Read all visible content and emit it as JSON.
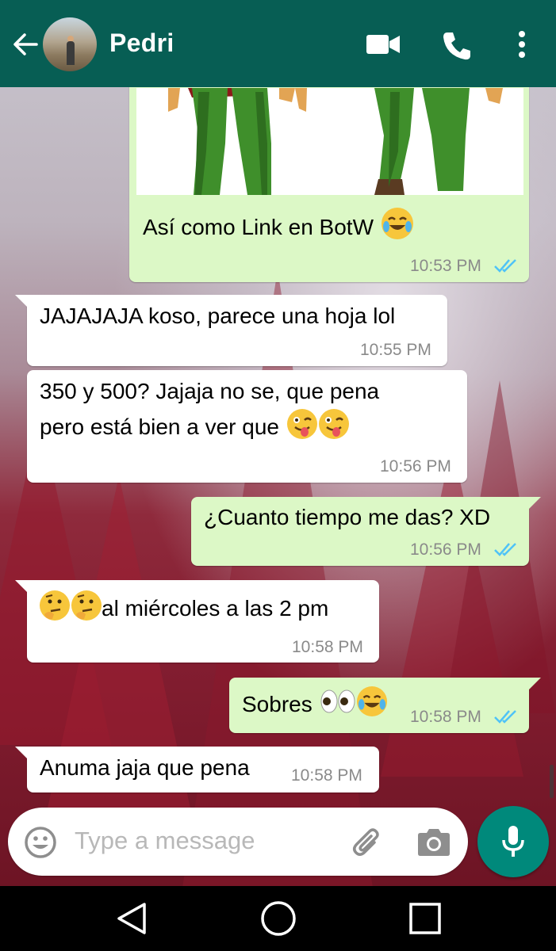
{
  "header": {
    "contact_name": "Pedri"
  },
  "messages": [
    {
      "direction": "out",
      "text": "Así como Link en BotW",
      "emoji": "tears-of-joy",
      "time": "10:53 PM",
      "status": "read"
    },
    {
      "direction": "in",
      "text": "JAJAJAJA koso, parece una hoja lol",
      "time": "10:55 PM"
    },
    {
      "direction": "in",
      "text_line1": "350 y 500? Jajaja no se,  que pena",
      "text_line2": "pero está bien a ver que",
      "emoji": "winking-tongue x2",
      "time": "10:56 PM"
    },
    {
      "direction": "out",
      "text": "¿Cuanto tiempo me das? XD",
      "time": "10:56 PM",
      "status": "read"
    },
    {
      "direction": "in",
      "text": "al miércoles a las 2 pm",
      "emoji": "thinking x2",
      "time": "10:58 PM"
    },
    {
      "direction": "out",
      "text": "Sobres",
      "emoji": "eyes, tears-of-joy",
      "time": "10:58 PM",
      "status": "read"
    },
    {
      "direction": "in",
      "text": "Anuma jaja que pena",
      "time": "10:58 PM"
    }
  ],
  "composer": {
    "placeholder": "Type a message"
  },
  "colors": {
    "header": "#075e54",
    "outgoing_bubble": "#dcf8c6",
    "incoming_bubble": "#ffffff",
    "read_ticks": "#4fc3f7",
    "mic_button": "#00897b"
  },
  "icons": [
    "back-arrow-icon",
    "video-call-icon",
    "phone-icon",
    "more-vert-icon",
    "emoji-icon",
    "attach-icon",
    "camera-icon",
    "mic-icon",
    "nav-back-icon",
    "nav-home-icon",
    "nav-recents-icon"
  ]
}
